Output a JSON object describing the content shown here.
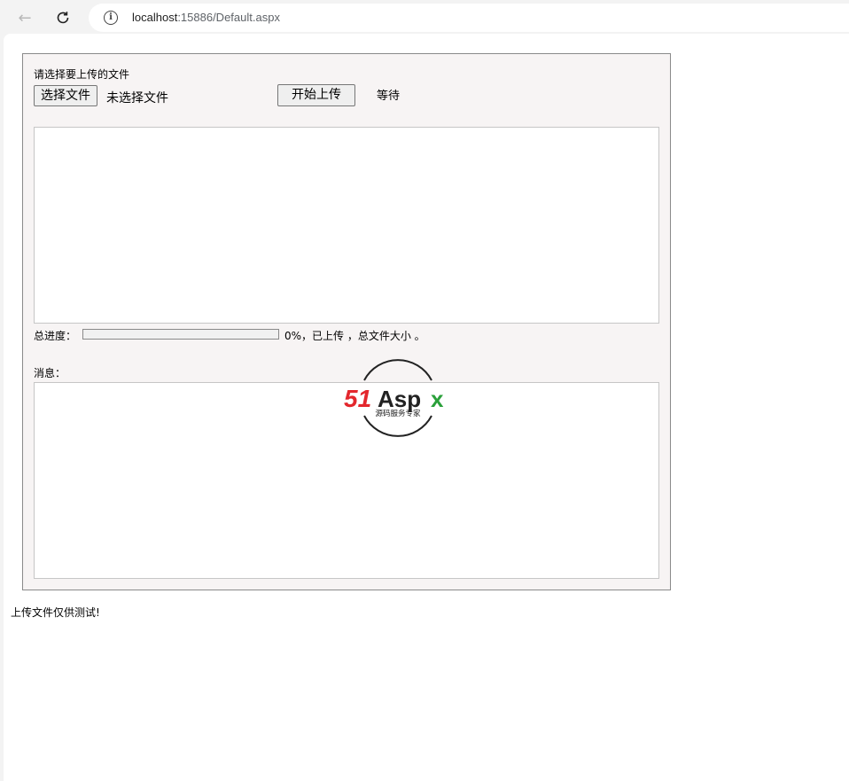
{
  "browser": {
    "url_host": "localhost",
    "url_rest": ":15886/Default.aspx"
  },
  "form": {
    "select_prompt": "请选择要上传的文件",
    "choose_file_label": "选择文件",
    "no_file_text": "未选择文件",
    "start_upload_label": "开始上传",
    "status_text": "等待",
    "progress_label": "总进度：",
    "progress_value": 0,
    "progress_text": "0%，已上传 ，总文件大小 。",
    "message_label": "消息："
  },
  "footer": {
    "note": "上传文件仅供测试!"
  },
  "watermark": {
    "brand_red": "51",
    "brand_black": "Asp",
    "brand_green": "x",
    "tagline": "源码服务专家",
    "colors": {
      "red": "#e3272d",
      "green": "#2aa03a",
      "dark": "#222222"
    }
  },
  "colors": {
    "panel_bg": "#f7f4f4",
    "panel_border": "#8a8a8a",
    "chrome_bg": "#f3f3f3"
  }
}
